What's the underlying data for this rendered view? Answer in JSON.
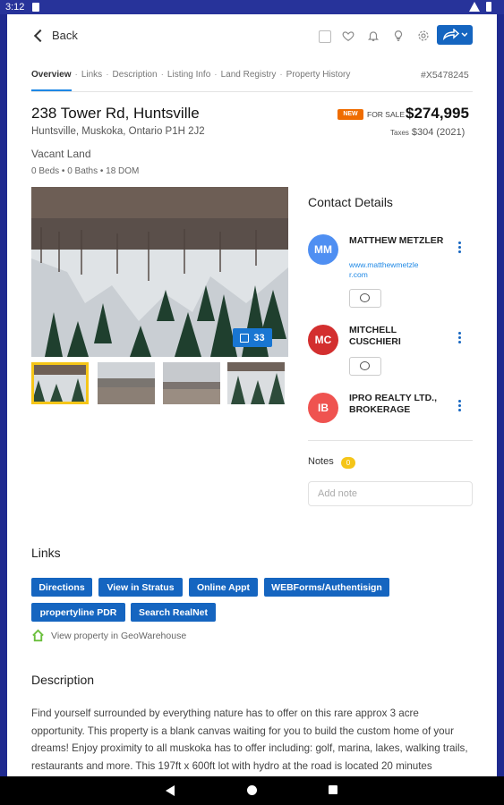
{
  "status_bar": {
    "time": "3:12"
  },
  "header": {
    "back_label": "Back"
  },
  "tabs": [
    {
      "label": "Overview",
      "active": true
    },
    {
      "label": "Links"
    },
    {
      "label": "Description"
    },
    {
      "label": "Listing Info"
    },
    {
      "label": "Land Registry"
    },
    {
      "label": "Property History"
    }
  ],
  "tab_separator": "·",
  "listing_id": "#X5478245",
  "property": {
    "address": "238 Tower Rd, Huntsville",
    "city_line": "Huntsville, Muskoka, Ontario P1H 2J2",
    "type": "Vacant Land",
    "stats": "0 Beds  •  0 Baths  •  18 DOM",
    "badge": "NEW",
    "status": "FOR SALE",
    "price": "$274,995",
    "taxes_label": "Taxes",
    "taxes_value": "$304 (2021)",
    "photo_count": "33"
  },
  "contacts": {
    "title": "Contact Details",
    "items": [
      {
        "initials": "MM",
        "name": "MATTHEW METZLER",
        "link": "www.matthewmetzler.com",
        "color": "#4f8ff2"
      },
      {
        "initials": "MC",
        "name": "MITCHELL CUSCHIERI",
        "color": "#d32f2f"
      },
      {
        "initials": "IB",
        "name": "IPRO REALTY LTD., BROKERAGE",
        "color": "#ef5350"
      }
    ]
  },
  "notes": {
    "label": "Notes",
    "count": "0",
    "placeholder": "Add note"
  },
  "links": {
    "title": "Links",
    "buttons": [
      "Directions",
      "View in Stratus",
      "Online Appt",
      "WEBForms/Authentisign",
      "propertyline PDR",
      "Search RealNet"
    ],
    "geo_text": "View property in GeoWarehouse"
  },
  "description": {
    "title": "Description",
    "text": "Find yourself surrounded by everything nature has to offer on this rare approx 3 acre opportunity. This property is a blank canvas waiting for you to build the custom home of your dreams! Enjoy proximity to all muskoka has to offer including: golf, marina, lakes, walking trails, restaurants and more. This 197ft x 600ft lot with hydro at the road is located 20 minutes"
  },
  "colors": {
    "brand": "#1565c0",
    "accent_badge": "#ef6c00",
    "status_bar": "#27339a",
    "highlight": "#f5c518"
  }
}
